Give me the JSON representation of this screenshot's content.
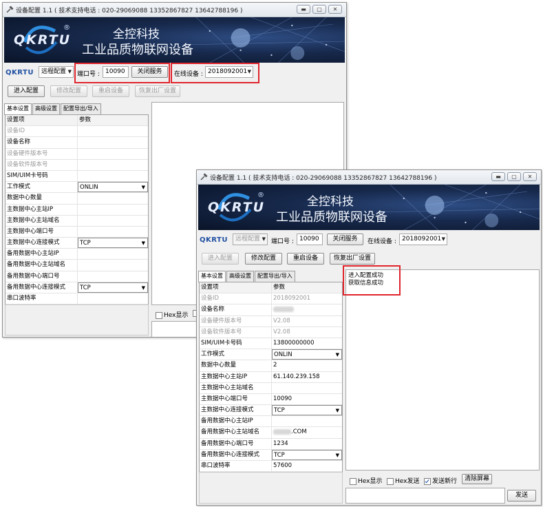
{
  "title": "设备配置 1.1 ( 技术支持电话 : 020-29069088  13352867827 13642788196 )",
  "banner": {
    "logo": "QKRTU",
    "reg": "®",
    "line1": "全控科技",
    "line2": "工业品质物联网设备"
  },
  "toolbar": {
    "logo": "QKRTU",
    "mode": "远程配置",
    "port_label": "端口号 :",
    "port_value": "10090",
    "close_service": "关闭服务",
    "online_label": "在线设备 :",
    "online_value": "2018092001"
  },
  "actions": {
    "enter": "进入配置",
    "modify": "修改配置",
    "restart": "重启设备",
    "restore": "恢复出厂设置"
  },
  "tabs": [
    "基本设置",
    "高级设置",
    "配置导出/导入"
  ],
  "grid": {
    "header": [
      "设置项",
      "参数"
    ],
    "rows": [
      {
        "label": "设备ID",
        "back_value": "",
        "front_value": "2018092001"
      },
      {
        "label": "设备名称",
        "back_value": "",
        "front_value": ""
      },
      {
        "label": "设备硬件版本号",
        "back_value": "",
        "front_value": "V2.08"
      },
      {
        "label": "设备软件版本号",
        "back_value": "",
        "front_value": "V2.08"
      },
      {
        "label": "SIM/UIM卡号码",
        "back_value": "",
        "front_value": "13800000000"
      },
      {
        "label": "工作模式",
        "back_value": "ONLIN",
        "front_value": "ONLIN"
      },
      {
        "label": "数据中心数量",
        "back_value": "",
        "front_value": "2"
      },
      {
        "label": "主数据中心主站IP",
        "back_value": "",
        "front_value": "61.140.239.158"
      },
      {
        "label": "主数据中心主站域名",
        "back_value": "",
        "front_value": ""
      },
      {
        "label": "主数据中心端口号",
        "back_value": "",
        "front_value": "10090"
      },
      {
        "label": "主数据中心连接模式",
        "back_value": "TCP",
        "front_value": "TCP"
      },
      {
        "label": "备用数据中心主站IP",
        "back_value": "",
        "front_value": ""
      },
      {
        "label": "备用数据中心主站域名",
        "back_value": "",
        "front_value": ".COM"
      },
      {
        "label": "备用数据中心端口号",
        "back_value": "",
        "front_value": "1234"
      },
      {
        "label": "备用数据中心连接模式",
        "back_value": "TCP",
        "front_value": "TCP"
      },
      {
        "label": "串口波特率",
        "back_value": "",
        "front_value": "57600"
      }
    ]
  },
  "log": [
    "进入配置成功",
    "获取信息成功"
  ],
  "options": {
    "hex_display": "Hex显示",
    "hex_send": "Hex发送",
    "send_newline": "发送新行",
    "clear_screen": "清除屏幕",
    "send": "发送"
  },
  "colors": {
    "highlight": "#e0242b",
    "banner_dark": "#0a1428",
    "logo_blue": "#1f4fa1"
  }
}
